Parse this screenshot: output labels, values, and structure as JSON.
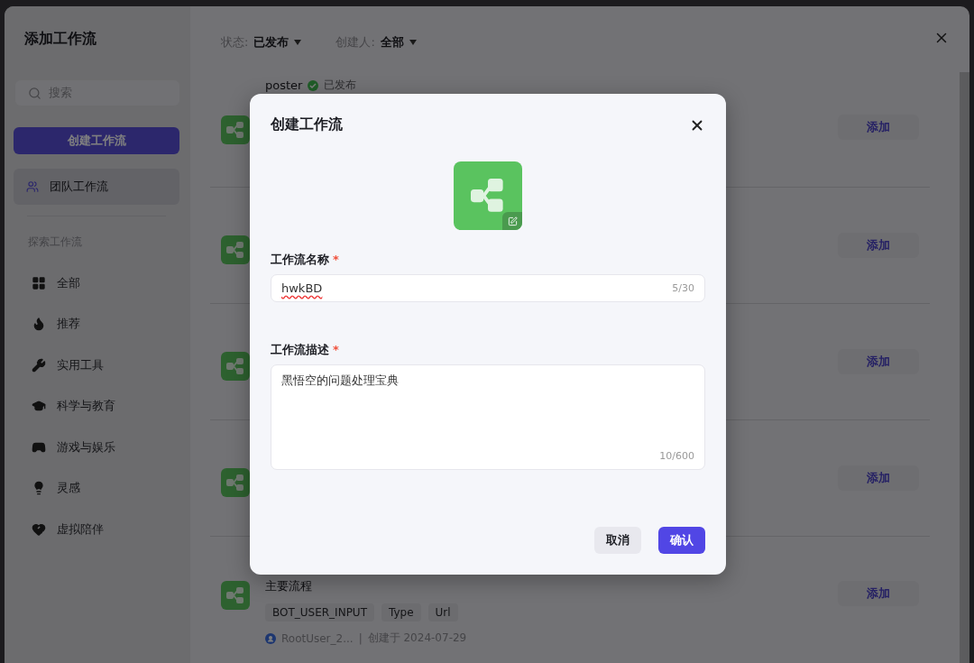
{
  "panel": {
    "title": "添加工作流",
    "search": {
      "placeholder": "搜索"
    },
    "create_button": "创建工作流",
    "team_item": {
      "label": "团队工作流",
      "selected": true
    },
    "explore_heading": "探索工作流",
    "categories": [
      {
        "label": "全部",
        "selected": false
      },
      {
        "label": "推荐",
        "selected": false
      },
      {
        "label": "实用工具",
        "selected": false
      },
      {
        "label": "科学与教育",
        "selected": false
      },
      {
        "label": "游戏与娱乐",
        "selected": false
      },
      {
        "label": "灵感",
        "selected": false
      },
      {
        "label": "虚拟陪伴",
        "selected": false
      }
    ]
  },
  "filters": [
    {
      "label": "状态:",
      "value": "已发布"
    },
    {
      "label": "创建人:",
      "value": "全部"
    }
  ],
  "workflows": [
    {
      "title": "poster",
      "status": "已发布",
      "add": "添加"
    },
    {
      "add": "添加"
    },
    {
      "add": "添加"
    },
    {
      "add": "添加"
    },
    {
      "title": "主要流程",
      "tags": [
        "BOT_USER_INPUT",
        "Type",
        "Url"
      ],
      "author": "RootUser_2...",
      "separator": "|",
      "created": "创建于 2024-07-29",
      "add": "添加"
    }
  ],
  "dialog": {
    "title": "创建工作流",
    "name_field": {
      "label": "工作流名称",
      "required_mark": "*",
      "value": "hwkBD",
      "count": "5/30"
    },
    "description_field": {
      "label": "工作流描述",
      "required_mark": "*",
      "value": "黑悟空的问题处理宝典",
      "count": "10/600"
    },
    "buttons": [
      {
        "label": "取消",
        "kind": "secondary"
      },
      {
        "label": "确认",
        "kind": "primary"
      }
    ]
  }
}
